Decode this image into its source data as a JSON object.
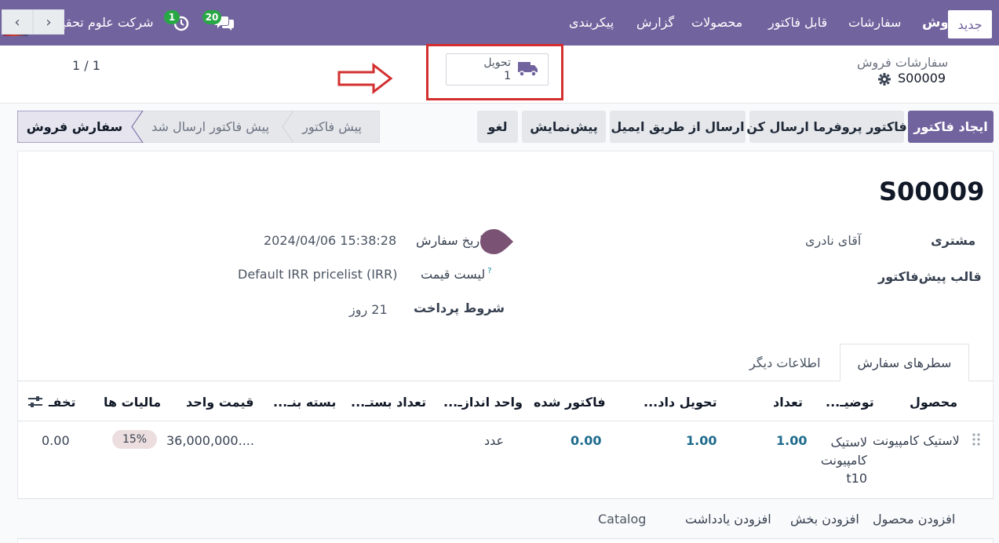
{
  "navbar": {
    "app_name": "فروش",
    "menu": [
      "سفارشات",
      "قابل فاکتور",
      "محصولات",
      "گزارش",
      "پیکربندی"
    ],
    "company": "شرکت علوم تحقیقات",
    "activity_count": "1",
    "message_count": "20"
  },
  "control_panel": {
    "new_button": "جدید",
    "breadcrumb_parent": "سفارشات فروش",
    "record_name": "S00009",
    "pager": "1 / 1",
    "delivery_label": "تحویل",
    "delivery_count": "1"
  },
  "actions": {
    "create_invoice": "ایجاد فاکتور",
    "send_proforma": "فاکتور پروفرما ارسال کن",
    "send_email": "ارسال از طریق ایمیل",
    "preview": "پیش‌نمایش",
    "cancel": "لغو"
  },
  "statusbar": [
    "سفارش فروش",
    "پیش فاکتور ارسال شد",
    "پیش فاکتور"
  ],
  "form": {
    "title": "S00009",
    "customer_label": "مشتری",
    "customer_value": "آقای نادری",
    "template_label": "قالب پیش‌فاکتور",
    "order_date_label": "تاریخ سفارش",
    "order_date_value": "2024/04/06 15:38:28",
    "pricelist_label": "لیست قیمت",
    "pricelist_value": "Default IRR pricelist (IRR)",
    "payment_terms_label": "شروط پرداخت",
    "payment_terms_value": "21 روز",
    "help_mark": "?"
  },
  "tabs": [
    "سطرهای سفارش",
    "اطلاعات دیگر"
  ],
  "table": {
    "headers": [
      "محصول",
      "توضیـ...",
      "تعداد",
      "تحویل داد...",
      "فاکتور شده",
      "واحد اندازـ...",
      "تعداد بستـ...",
      "بسته بنـ...",
      "قیمت واحد",
      "مالیات ها",
      "تخفـ"
    ],
    "row": {
      "product": "لاستیک کامپیونت",
      "description": [
        "لاستیک",
        "کامپیونت",
        "t10"
      ],
      "quantity": "1.00",
      "delivered": "1.00",
      "invoiced": "0.00",
      "uom": "عدد",
      "unit_price": "36,000,000....",
      "tax": "15%",
      "discount": "0.00"
    },
    "add_links": [
      "افزودن محصول",
      "افزودن بخش",
      "افزودن یادداشت",
      "Catalog"
    ]
  }
}
